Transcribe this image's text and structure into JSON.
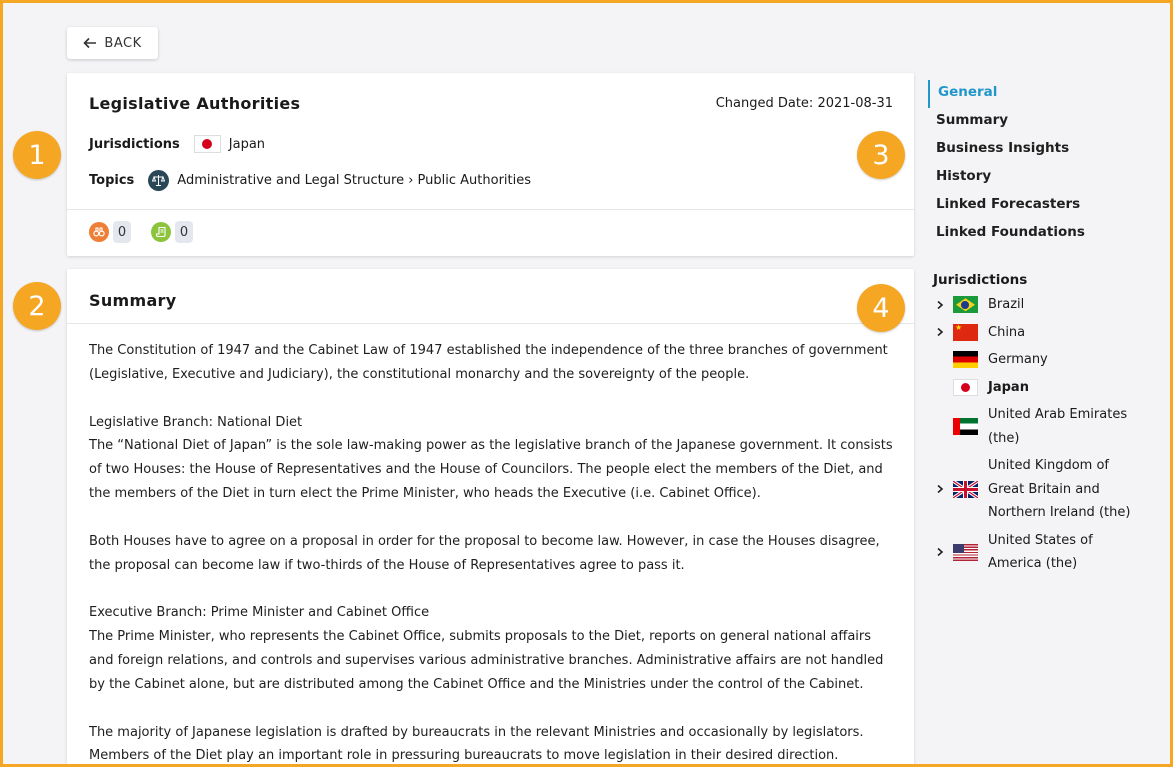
{
  "back_button": {
    "label": "BACK"
  },
  "detail": {
    "title": "Legislative Authorities",
    "changed_date": "Changed Date: 2021-08-31",
    "jurisdictions_label": "Jurisdictions",
    "jurisdiction_value": "Japan",
    "topics_label": "Topics",
    "topics_value": "Administrative and Legal Structure › Public Authorities",
    "stat1_count": "0",
    "stat2_count": "0"
  },
  "summary": {
    "title": "Summary",
    "p1": "The Constitution of 1947 and the Cabinet Law of 1947 established the independence of the three branches of government (Legislative, Executive and Judiciary), the constitutional monarchy and the sovereignty of the people.",
    "h2": "Legislative Branch: National Diet",
    "p2": "The “National Diet of Japan” is the sole law-making power as the legislative branch of the Japanese government. It consists of two Houses: the House of Representatives and the House of Councilors. The people elect the members of the Diet, and the members of the Diet in turn elect the Prime Minister, who heads the Executive (i.e. Cabinet Office).",
    "p3": "Both Houses have to agree on a proposal in order for the proposal to become law. However, in case the Houses disagree, the proposal can become law if two-thirds of the House of Representatives agree to pass it.",
    "h4": "Executive Branch: Prime Minister and Cabinet Office",
    "p4": "The Prime Minister, who represents the Cabinet Office, submits proposals to the Diet, reports on general national affairs and foreign relations, and controls and supervises various administrative branches. Administrative affairs are not handled by the Cabinet alone, but are distributed among the Cabinet Office and the Ministries under the control of the Cabinet.",
    "p5": "The majority of Japanese legislation is drafted by bureaucrats in the relevant Ministries and occasionally by legislators. Members of the Diet play an important role in pressuring bureaucrats to move legislation in their desired direction."
  },
  "badges": [
    "1",
    "2",
    "3",
    "4"
  ],
  "nav": {
    "items": [
      "General",
      "Summary",
      "Business Insights",
      "History",
      "Linked Forecasters",
      "Linked Foundations"
    ]
  },
  "jurisdictions": {
    "title": "Jurisdictions",
    "items": [
      "Brazil",
      "China",
      "Germany",
      "Japan",
      "United Arab Emirates (the)",
      "United Kingdom of Great Britain and Northern Ireland (the)",
      "United States of America (the)"
    ]
  },
  "colors": {
    "accent": "#2196c9",
    "badge": "#f5a623"
  },
  "icons": {
    "back": "arrow-left-icon",
    "topic": "scales-icon",
    "stat1": "binoculars-icon",
    "stat2": "scroll-icon",
    "expand": "chevron-right-icon"
  }
}
